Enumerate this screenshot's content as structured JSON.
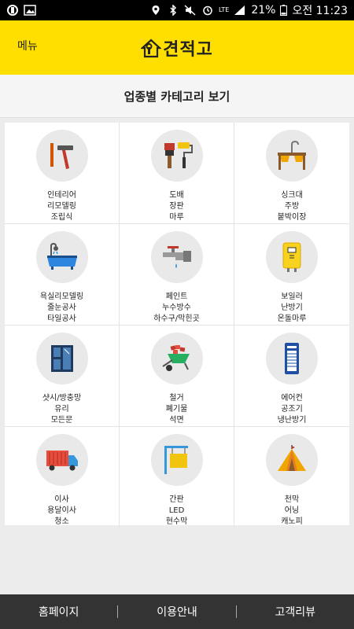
{
  "status_bar": {
    "battery": "21%",
    "time": "오전 11:23",
    "network": "LTE"
  },
  "header": {
    "menu_label": "메뉴",
    "logo_text": "견적고",
    "brand_color": "#ffdf00"
  },
  "section": {
    "title": "업종별 카테고리 보기"
  },
  "categories": [
    {
      "icon": "hammer-icon",
      "lines": [
        "인테리어",
        "리모델링",
        "조립식"
      ]
    },
    {
      "icon": "paint-brush-roller-icon",
      "lines": [
        "도배",
        "장판",
        "마루"
      ]
    },
    {
      "icon": "sink-icon",
      "lines": [
        "싱크대",
        "주방",
        "붙박이장"
      ]
    },
    {
      "icon": "bathtub-icon",
      "lines": [
        "욕실리모델링",
        "줄눈공사",
        "타일공사"
      ]
    },
    {
      "icon": "faucet-icon",
      "lines": [
        "페인트",
        "누수방수",
        "하수구/막힌곳"
      ]
    },
    {
      "icon": "boiler-icon",
      "lines": [
        "보일러",
        "난방기",
        "온돌마루"
      ]
    },
    {
      "icon": "window-icon",
      "lines": [
        "샷시/방충망",
        "유리",
        "모든문"
      ]
    },
    {
      "icon": "wheelbarrow-icon",
      "lines": [
        "철거",
        "폐기물",
        "석면"
      ]
    },
    {
      "icon": "air-conditioner-icon",
      "lines": [
        "에어컨",
        "공조기",
        "냉난방기"
      ]
    },
    {
      "icon": "moving-truck-icon",
      "lines": [
        "이사",
        "용달이사",
        "청소"
      ]
    },
    {
      "icon": "signboard-icon",
      "lines": [
        "간판",
        "LED",
        "현수막"
      ]
    },
    {
      "icon": "tent-icon",
      "lines": [
        "천막",
        "어닝",
        "캐노피"
      ]
    }
  ],
  "bottom_nav": {
    "home": "홈페이지",
    "guide": "이용안내",
    "reviews": "고객리뷰"
  }
}
